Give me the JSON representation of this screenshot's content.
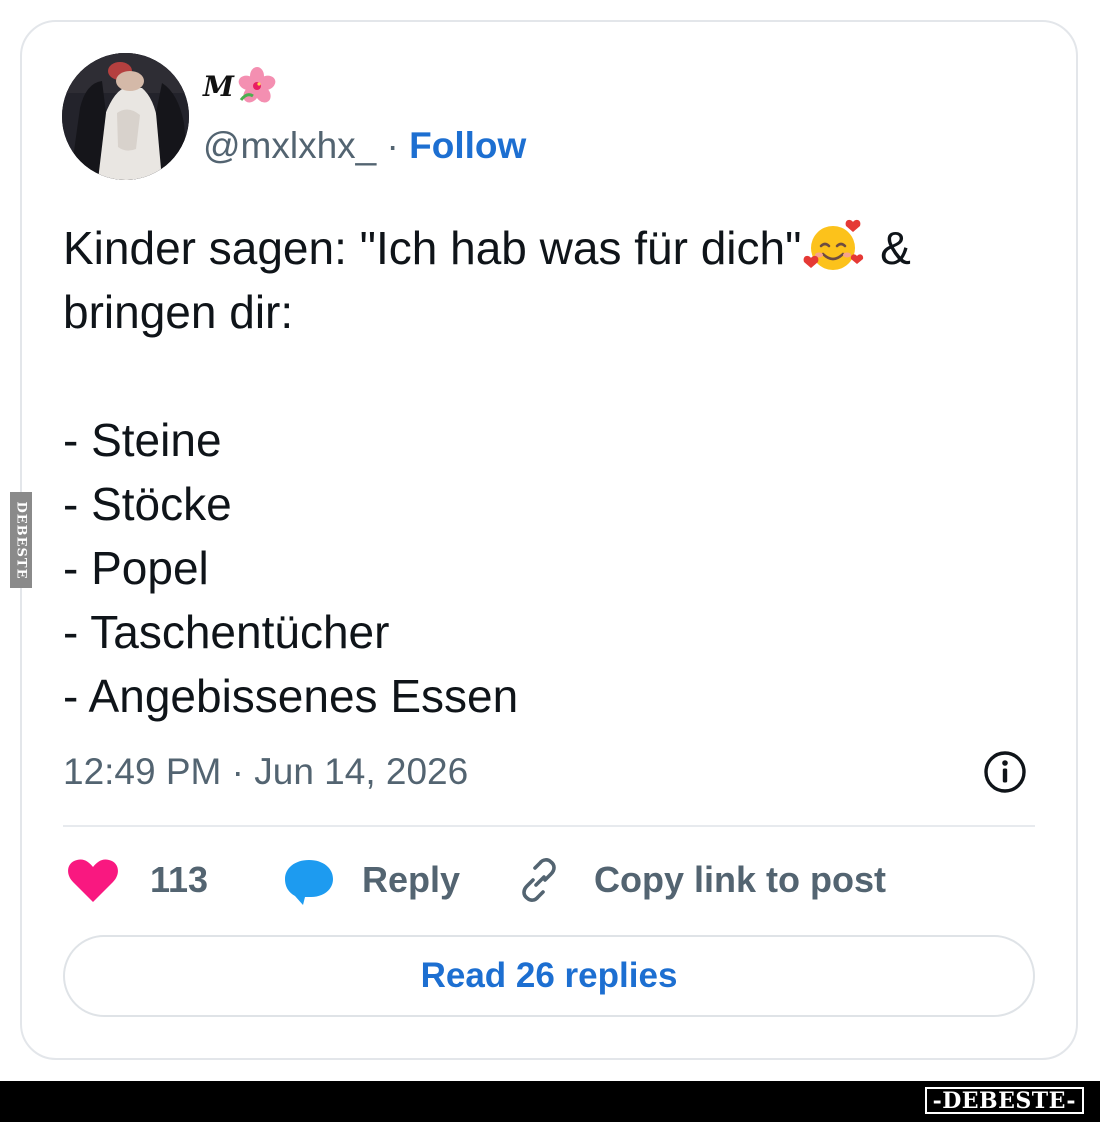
{
  "author": {
    "display_name": "M",
    "display_name_icon": "hibiscus-flower-emoji",
    "handle": "@mxlxhx_",
    "separator": " · ",
    "follow_label": "Follow"
  },
  "tweet": {
    "text_line1_before_emoji": "Kinder sagen: \"Ich hab was für dich\"",
    "text_line1_emoji": "smiling-face-with-hearts-emoji",
    "text_line1_after_emoji": " &",
    "text_line2": "bringen dir:",
    "list_items": [
      "- Steine",
      "- Stöcke",
      "- Popel",
      "- Taschentücher",
      "- Angebissenes Essen"
    ],
    "timestamp": "12:49 PM · Jun 14, 2026"
  },
  "actions": {
    "like_icon": "heart-icon",
    "like_count": "113",
    "reply_icon": "speech-bubble-icon",
    "reply_label": "Reply",
    "copy_icon": "link-icon",
    "copy_label": "Copy link to post",
    "info_icon": "info-icon"
  },
  "read_replies_label": "Read 26 replies",
  "watermark": {
    "side_text": "DEBESTE",
    "bottom_text": "-DEBESTE-"
  },
  "colors": {
    "accent_blue": "#1d6fd1",
    "heart_pink": "#f91880",
    "reply_blue": "#1d9bf0",
    "muted_text": "#536471"
  }
}
